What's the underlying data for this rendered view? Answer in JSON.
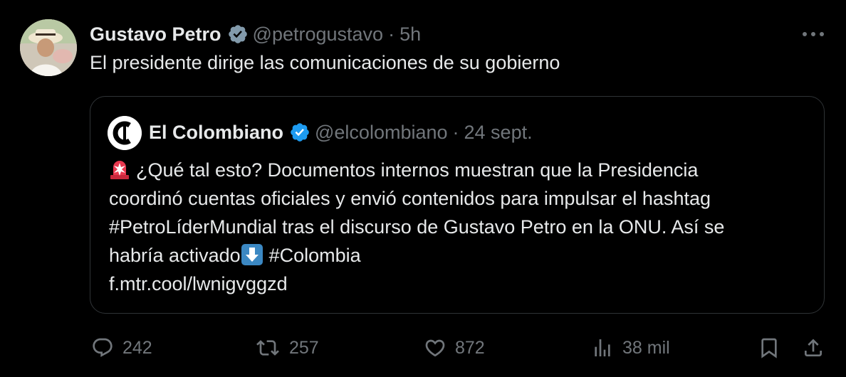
{
  "tweet": {
    "author_name": "Gustavo Petro",
    "author_handle": "@petrogustavo",
    "separator": "·",
    "time": "5h",
    "text": "El presidente dirige las comunicaciones de su gobierno",
    "more_icon": "more-horizontal-icon",
    "verified_icon": "verified-badge-icon"
  },
  "quoted": {
    "author_name": "El Colombiano",
    "author_handle": "@elcolombiano",
    "separator": "·",
    "date": "24 sept.",
    "line1": "¿Qué tal esto? Documentos internos muestran que la Presidencia",
    "line2": "coordinó cuentas oficiales y envió contenidos para impulsar el hashtag",
    "line3": "#PetroLíderMundial tras el discurso de Gustavo Petro en la ONU. Así se",
    "line4_a": "habría activado",
    "line4_b": "#Colombia",
    "link": "f.mtr.cool/lwnigvggzd",
    "siren_emoji": "police-light-emoji",
    "arrow_emoji": "down-arrow-emoji"
  },
  "actions": {
    "replies": "242",
    "reposts": "257",
    "likes": "872",
    "views": "38 mil"
  },
  "colors": {
    "background": "#000000",
    "text": "#e7e9ea",
    "muted": "#71767b",
    "border": "#2f3336",
    "verified": "#1d9bf0"
  }
}
